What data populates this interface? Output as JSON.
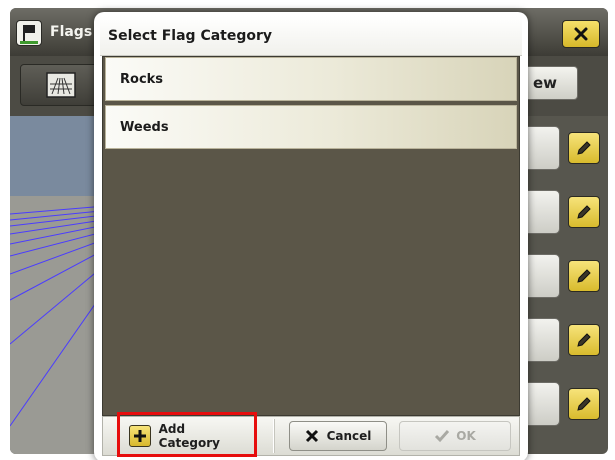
{
  "background_app": {
    "title": "Flags",
    "view_button_label": "ew",
    "icons": {
      "app_icon": "flag-icon",
      "close": "close-icon",
      "map_view": "map-view-icon",
      "edit": "pencil-icon"
    },
    "row_count": 5
  },
  "dialog": {
    "title": "Select Flag Category",
    "categories": [
      {
        "label": "Rocks"
      },
      {
        "label": "Weeds"
      }
    ],
    "footer": {
      "add_label": "Add Category",
      "add_icon": "plus-icon",
      "cancel_label": "Cancel",
      "cancel_icon": "x-icon",
      "ok_label": "OK",
      "ok_icon": "check-icon",
      "ok_enabled": false
    }
  },
  "colors": {
    "dialog_body": "#5b5648",
    "accent_yellow": "#f2d64a",
    "highlight": "#e60d0d"
  }
}
